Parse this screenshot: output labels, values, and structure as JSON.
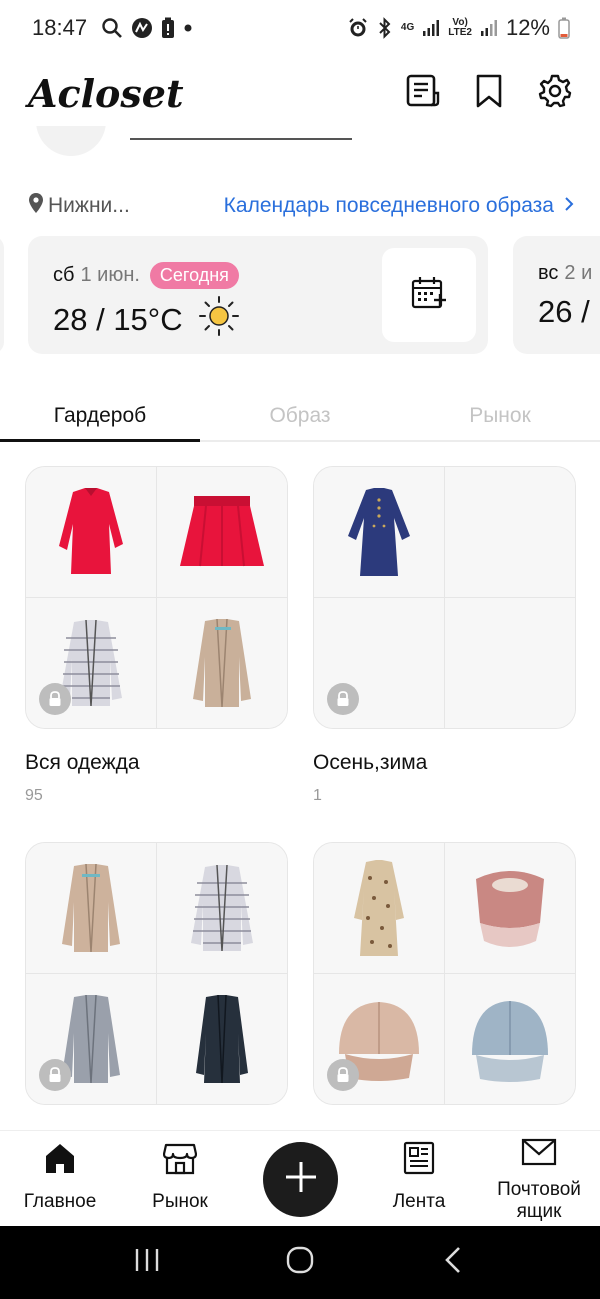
{
  "status_bar": {
    "time": "18:47",
    "network_4g": "4G",
    "volte_top": "Vo)",
    "volte_bottom": "LTE2",
    "battery": "12%"
  },
  "header": {
    "title": "Acloset",
    "icons": [
      "journal-icon",
      "bookmark-icon",
      "gear-icon"
    ]
  },
  "location": {
    "place": "Нижни...",
    "calendar_link": "Календарь повседневного образа"
  },
  "weather": {
    "today": {
      "dow": "сб",
      "date": "1 июн.",
      "badge": "Сегодня",
      "temp": "28 / 15°C"
    },
    "next": {
      "dow": "вс",
      "date": "2 и",
      "temp": "26 / "
    }
  },
  "tabs": [
    "Гардероб",
    "Образ",
    "Рынок"
  ],
  "active_tab": "Гардероб",
  "cards": [
    {
      "title": "Вся одежда",
      "count": "95",
      "items": [
        "red-sweater",
        "red-skirt",
        "striped-cardigan",
        "beige-cardigan"
      ]
    },
    {
      "title": "Осень,зима",
      "count": "1",
      "items": [
        "navy-dress",
        "",
        "",
        ""
      ]
    },
    {
      "title": "",
      "count": "",
      "items": [
        "beige-cardigan",
        "striped-cardigan",
        "grey-cardigan",
        "dark-cardigan"
      ]
    },
    {
      "title": "",
      "count": "",
      "items": [
        "patterned-robe",
        "pink-visor",
        "beige-cap",
        "blue-cap"
      ]
    }
  ],
  "bottom_nav": {
    "home": "Главное",
    "market": "Рынок",
    "feed": "Лента",
    "mailbox": "Почтовой ящик"
  },
  "colors": {
    "accent_link": "#2a6fdc",
    "today_badge": "#f07aa4",
    "fab": "#1c1c1c",
    "red_garment": "#e8143c",
    "navy_garment": "#2c3a7c"
  }
}
